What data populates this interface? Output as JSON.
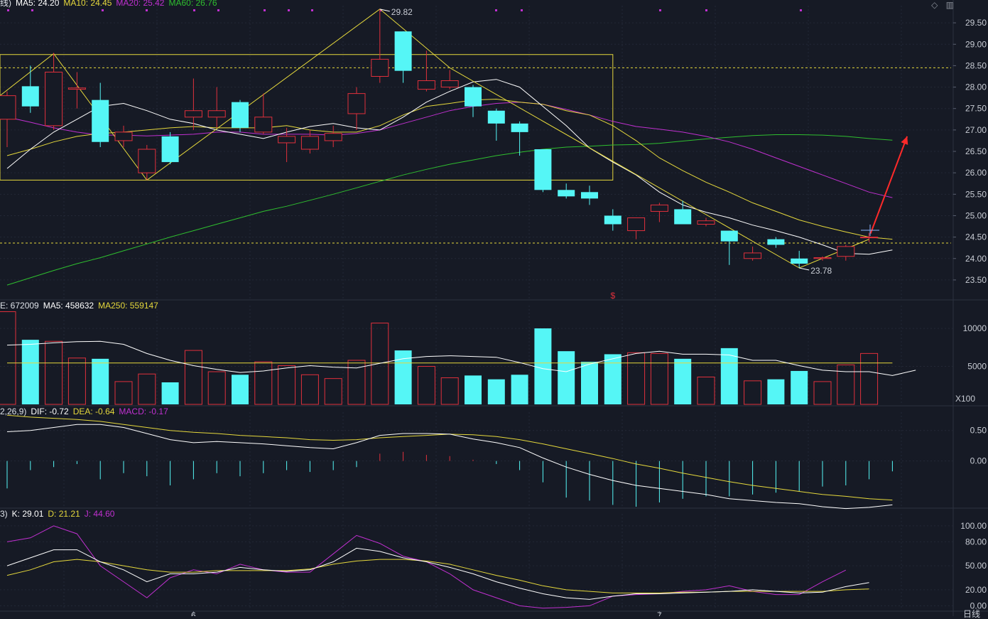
{
  "colors": {
    "background": "#161a25",
    "up": "#e0303c",
    "down": "#55f6f6",
    "ma5": "#ffffff",
    "ma10": "#e5d83c",
    "ma20": "#c030d0",
    "ma60": "#2fbf2f",
    "dea": "#e5d83c",
    "macd": "#c030d0",
    "arrow": "#ff2a2a",
    "axis_text": "#c8ccd4",
    "label_text": "#dde1e8"
  },
  "header": {
    "main": [
      {
        "text": "线)",
        "color": "#dde1e8"
      },
      {
        "text": "MA5: 24.20",
        "color": "#ffffff"
      },
      {
        "text": "MA10: 24.45",
        "color": "#e5d83c"
      },
      {
        "text": "MA20: 25.42",
        "color": "#c030d0"
      },
      {
        "text": "MA60: 26.76",
        "color": "#2fbf2f"
      }
    ],
    "volume": [
      {
        "text": "E: 672009",
        "color": "#dde1e8"
      },
      {
        "text": "MA5: 458632",
        "color": "#ffffff"
      },
      {
        "text": "MA250: 559147",
        "color": "#e5d83c"
      }
    ],
    "macd": [
      {
        "text": "2,26,9)",
        "color": "#dde1e8"
      },
      {
        "text": "DIF: -0.72",
        "color": "#ffffff"
      },
      {
        "text": "DEA: -0.64",
        "color": "#e5d83c"
      },
      {
        "text": "MACD: -0.17",
        "color": "#c030d0"
      }
    ],
    "kdj": [
      {
        "text": "3)",
        "color": "#dde1e8"
      },
      {
        "text": "K: 29.01",
        "color": "#ffffff"
      },
      {
        "text": "D: 21.21",
        "color": "#e5d83c"
      },
      {
        "text": "J: 44.60",
        "color": "#c030d0"
      }
    ]
  },
  "corner_icons": [
    "diamond-icon",
    "layout-icon"
  ],
  "bottom_right_label": "日线",
  "volume_unit_label": "X100",
  "x_axis_labels": [
    {
      "text": "6",
      "index": 8
    },
    {
      "text": "7",
      "index": 28
    }
  ],
  "event_marker": {
    "text": "$",
    "index": 26
  },
  "chart_data": [
    {
      "type": "candlestick",
      "title": "",
      "ylim": [
        23.2,
        29.9
      ],
      "yticks": [
        23.5,
        24.0,
        24.5,
        25.0,
        25.5,
        26.0,
        26.5,
        27.0,
        27.5,
        28.0,
        28.5,
        29.0,
        29.5
      ],
      "reference_lines": [
        28.45,
        24.36
      ],
      "annotations": [
        {
          "text": "29.82",
          "index": 16,
          "value": 29.82
        },
        {
          "text": "23.78",
          "index": 34,
          "value": 23.78
        }
      ],
      "range_box": {
        "from_index": -0.5,
        "to_index": 26,
        "high": 28.76,
        "low": 25.83
      },
      "zigzag": [
        {
          "index": -0.5,
          "value": 27.8
        },
        {
          "index": 2,
          "value": 28.78
        },
        {
          "index": 6,
          "value": 25.83
        },
        {
          "index": 16,
          "value": 29.82
        },
        {
          "index": 19,
          "value": 28.45
        },
        {
          "index": 34,
          "value": 23.78
        },
        {
          "index": 37,
          "value": 24.45
        }
      ],
      "candles": [
        {
          "o": 27.25,
          "h": 27.9,
          "l": 26.6,
          "c": 27.8
        },
        {
          "o": 28.02,
          "h": 28.5,
          "l": 27.4,
          "c": 27.55
        },
        {
          "o": 27.1,
          "h": 28.8,
          "l": 27.0,
          "c": 28.35
        },
        {
          "o": 27.95,
          "h": 28.35,
          "l": 27.5,
          "c": 27.98
        },
        {
          "o": 27.7,
          "h": 28.1,
          "l": 26.6,
          "c": 26.72
        },
        {
          "o": 26.75,
          "h": 27.1,
          "l": 26.6,
          "c": 26.95
        },
        {
          "o": 26.0,
          "h": 26.65,
          "l": 25.83,
          "c": 26.55
        },
        {
          "o": 26.85,
          "h": 26.95,
          "l": 26.2,
          "c": 26.25
        },
        {
          "o": 27.3,
          "h": 28.2,
          "l": 27.0,
          "c": 27.45
        },
        {
          "o": 27.3,
          "h": 28.0,
          "l": 27.05,
          "c": 27.45
        },
        {
          "o": 27.65,
          "h": 27.7,
          "l": 26.95,
          "c": 27.05
        },
        {
          "o": 26.95,
          "h": 27.85,
          "l": 26.9,
          "c": 27.3
        },
        {
          "o": 26.7,
          "h": 27.05,
          "l": 26.25,
          "c": 26.85
        },
        {
          "o": 26.55,
          "h": 27.0,
          "l": 26.45,
          "c": 26.85
        },
        {
          "o": 26.75,
          "h": 27.1,
          "l": 26.6,
          "c": 26.92
        },
        {
          "o": 27.38,
          "h": 28.0,
          "l": 27.0,
          "c": 27.85
        },
        {
          "o": 28.25,
          "h": 29.82,
          "l": 28.1,
          "c": 28.65
        },
        {
          "o": 29.3,
          "h": 29.3,
          "l": 28.1,
          "c": 28.38
        },
        {
          "o": 27.95,
          "h": 28.85,
          "l": 27.9,
          "c": 28.15
        },
        {
          "o": 28.0,
          "h": 28.4,
          "l": 27.95,
          "c": 28.15
        },
        {
          "o": 28.0,
          "h": 28.05,
          "l": 27.3,
          "c": 27.55
        },
        {
          "o": 27.45,
          "h": 27.5,
          "l": 26.75,
          "c": 27.15
        },
        {
          "o": 27.15,
          "h": 27.2,
          "l": 26.4,
          "c": 26.95
        },
        {
          "o": 26.55,
          "h": 26.55,
          "l": 25.55,
          "c": 25.6
        },
        {
          "o": 25.6,
          "h": 25.75,
          "l": 25.4,
          "c": 25.45
        },
        {
          "o": 25.55,
          "h": 25.7,
          "l": 25.25,
          "c": 25.4
        },
        {
          "o": 25.0,
          "h": 25.15,
          "l": 24.65,
          "c": 24.8
        },
        {
          "o": 24.65,
          "h": 24.95,
          "l": 24.45,
          "c": 24.95
        },
        {
          "o": 25.1,
          "h": 25.3,
          "l": 24.85,
          "c": 25.25
        },
        {
          "o": 25.15,
          "h": 25.35,
          "l": 24.8,
          "c": 24.8
        },
        {
          "o": 24.8,
          "h": 24.95,
          "l": 24.75,
          "c": 24.88
        },
        {
          "o": 24.65,
          "h": 24.65,
          "l": 23.85,
          "c": 24.4
        },
        {
          "o": 24.0,
          "h": 24.28,
          "l": 23.95,
          "c": 24.13
        },
        {
          "o": 24.45,
          "h": 24.5,
          "l": 24.25,
          "c": 24.32
        },
        {
          "o": 24.0,
          "h": 24.18,
          "l": 23.78,
          "c": 23.88
        },
        {
          "o": 24.0,
          "h": 24.05,
          "l": 23.95,
          "c": 24.02
        },
        {
          "o": 24.05,
          "h": 24.32,
          "l": 23.95,
          "c": 24.28
        },
        {
          "o": 24.5,
          "h": 24.6,
          "l": 24.38,
          "c": 24.5
        }
      ],
      "ma5": [
        26.1,
        26.55,
        26.95,
        27.25,
        27.55,
        27.62,
        27.45,
        27.25,
        27.15,
        27.0,
        26.9,
        26.8,
        26.95,
        27.08,
        27.15,
        27.05,
        27.0,
        27.3,
        27.65,
        27.9,
        28.12,
        28.18,
        28.0,
        27.55,
        27.1,
        26.58,
        26.25,
        25.95,
        25.55,
        25.25,
        25.08,
        24.95,
        24.78,
        24.65,
        24.5,
        24.32,
        24.12,
        24.1,
        24.2
      ],
      "ma10": [
        26.4,
        26.55,
        26.72,
        26.85,
        26.92,
        26.95,
        27.0,
        27.05,
        27.08,
        27.05,
        27.05,
        27.05,
        27.1,
        27.0,
        26.95,
        26.95,
        27.1,
        27.35,
        27.55,
        27.62,
        27.7,
        27.72,
        27.65,
        27.6,
        27.45,
        27.35,
        27.1,
        26.75,
        26.35,
        26.05,
        25.78,
        25.55,
        25.3,
        25.1,
        24.9,
        24.75,
        24.62,
        24.5,
        24.45
      ],
      "ma20": [
        27.3,
        27.18,
        27.05,
        26.95,
        26.88,
        26.88,
        26.86,
        26.88,
        26.9,
        26.95,
        26.95,
        26.9,
        26.9,
        26.9,
        26.88,
        26.92,
        27.0,
        27.15,
        27.3,
        27.45,
        27.55,
        27.62,
        27.65,
        27.6,
        27.48,
        27.35,
        27.2,
        27.08,
        27.02,
        26.95,
        26.85,
        26.72,
        26.55,
        26.35,
        26.15,
        25.95,
        25.75,
        25.55,
        25.42
      ],
      "ma60": [
        23.38,
        23.55,
        23.72,
        23.88,
        24.02,
        24.18,
        24.34,
        24.5,
        24.65,
        24.8,
        24.95,
        25.1,
        25.22,
        25.36,
        25.5,
        25.65,
        25.8,
        25.95,
        26.08,
        26.2,
        26.3,
        26.4,
        26.48,
        26.55,
        26.6,
        26.62,
        26.65,
        26.66,
        26.69,
        26.74,
        26.79,
        26.83,
        26.87,
        26.89,
        26.89,
        26.88,
        26.85,
        26.8,
        26.76
      ],
      "arrow": {
        "from_index": 37,
        "from_value": 24.58,
        "to_index": 39,
        "to_value": 26.85
      }
    },
    {
      "type": "bar",
      "title": "",
      "ylim": [
        0,
        13000
      ],
      "yticks": [
        5000,
        10000
      ],
      "values": [
        12200,
        8500,
        8300,
        6100,
        6000,
        3000,
        4000,
        2900,
        7100,
        4300,
        3900,
        5600,
        5100,
        3900,
        3400,
        5800,
        10700,
        7100,
        5000,
        3500,
        3800,
        3300,
        3900,
        10000,
        7000,
        5600,
        6600,
        6800,
        6700,
        6000,
        3600,
        7400,
        3100,
        3300,
        4400,
        3000,
        5200,
        6700
      ],
      "ma5": [
        7800,
        7900,
        8100,
        8250,
        8300,
        7900,
        6700,
        5800,
        5100,
        4600,
        4200,
        4400,
        4800,
        5100,
        4900,
        4800,
        5400,
        6000,
        6300,
        6400,
        6300,
        6200,
        5500,
        4700,
        4300,
        5300,
        6000,
        6700,
        7000,
        6600,
        6600,
        6500,
        5800,
        5800,
        5100,
        4500,
        4300,
        4300,
        3800,
        4500
      ],
      "ma250": [
        5450,
        5450,
        5450,
        5450,
        5450,
        5450,
        5450,
        5450,
        5450,
        5450,
        5450,
        5450,
        5450,
        5450,
        5450,
        5450,
        5450,
        5450,
        5450,
        5450,
        5450,
        5450,
        5450,
        5450,
        5450,
        5450,
        5450,
        5450,
        5450,
        5450,
        5450,
        5450,
        5450,
        5450,
        5450,
        5450,
        5450,
        5450,
        5450
      ]
    },
    {
      "type": "bar",
      "title": "MACD",
      "ylim": [
        -0.75,
        0.8
      ],
      "yticks": [
        0.0,
        0.5
      ],
      "macd": [
        -0.45,
        -0.15,
        -0.1,
        -0.05,
        -0.3,
        -0.2,
        -0.25,
        -0.4,
        -0.3,
        -0.2,
        -0.25,
        -0.2,
        -0.15,
        -0.18,
        -0.15,
        -0.1,
        0.12,
        0.15,
        0.1,
        0.08,
        0.02,
        -0.05,
        -0.15,
        -0.35,
        -0.6,
        -0.65,
        -0.72,
        -0.75,
        -0.68,
        -0.62,
        -0.58,
        -0.58,
        -0.55,
        -0.52,
        -0.5,
        -0.42,
        -0.4,
        -0.3,
        -0.17
      ],
      "dif": [
        0.48,
        0.5,
        0.55,
        0.6,
        0.6,
        0.55,
        0.45,
        0.35,
        0.3,
        0.32,
        0.3,
        0.28,
        0.25,
        0.22,
        0.2,
        0.3,
        0.42,
        0.45,
        0.45,
        0.44,
        0.36,
        0.3,
        0.22,
        0.05,
        -0.1,
        -0.22,
        -0.32,
        -0.4,
        -0.45,
        -0.5,
        -0.55,
        -0.62,
        -0.65,
        -0.68,
        -0.7,
        -0.75,
        -0.78,
        -0.76,
        -0.72
      ],
      "dea": [
        0.75,
        0.72,
        0.7,
        0.68,
        0.65,
        0.6,
        0.55,
        0.5,
        0.47,
        0.45,
        0.42,
        0.4,
        0.38,
        0.35,
        0.34,
        0.35,
        0.38,
        0.4,
        0.42,
        0.44,
        0.43,
        0.4,
        0.35,
        0.28,
        0.2,
        0.12,
        0.04,
        -0.05,
        -0.12,
        -0.2,
        -0.27,
        -0.34,
        -0.4,
        -0.45,
        -0.5,
        -0.55,
        -0.58,
        -0.62,
        -0.64
      ]
    },
    {
      "type": "line",
      "title": "KDJ",
      "ylim": [
        -5,
        115
      ],
      "yticks": [
        0.0,
        20.0,
        50.0,
        80.0,
        100.0
      ],
      "k": [
        50,
        60,
        70,
        70,
        55,
        45,
        30,
        40,
        40,
        42,
        48,
        45,
        43,
        45,
        55,
        72,
        68,
        60,
        55,
        48,
        40,
        30,
        22,
        15,
        10,
        8,
        12,
        15,
        15,
        16,
        17,
        18,
        20,
        18,
        16,
        17,
        24,
        29
      ],
      "d": [
        38,
        45,
        55,
        58,
        55,
        50,
        45,
        42,
        42,
        44,
        44,
        44,
        44,
        46,
        52,
        56,
        58,
        58,
        56,
        52,
        45,
        38,
        32,
        25,
        20,
        18,
        16,
        16,
        16,
        17,
        17,
        18,
        18,
        18,
        18,
        18,
        20,
        21
      ],
      "j": [
        80,
        85,
        100,
        90,
        50,
        30,
        10,
        35,
        45,
        40,
        52,
        45,
        42,
        42,
        65,
        88,
        78,
        62,
        55,
        40,
        20,
        10,
        0,
        -3,
        -2,
        0,
        12,
        14,
        15,
        18,
        20,
        25,
        18,
        14,
        14,
        30,
        44.6
      ]
    }
  ]
}
